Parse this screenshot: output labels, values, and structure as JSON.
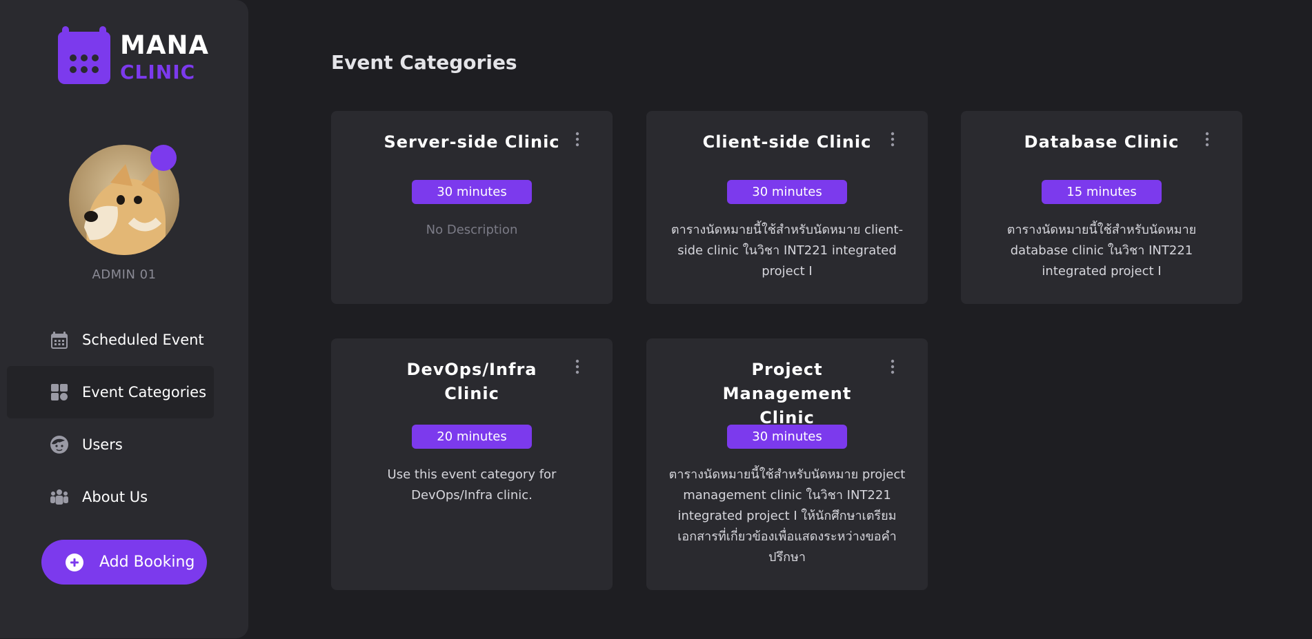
{
  "app": {
    "logo_title": "MANA",
    "logo_subtitle": "CLINIC",
    "accent_color": "#7c3aed"
  },
  "profile": {
    "name": "ADMIN 01",
    "status_color": "#7c3aed"
  },
  "sidebar": {
    "items": [
      {
        "label": "Scheduled Event",
        "icon": "calendar-icon",
        "active": false
      },
      {
        "label": "Event Categories",
        "icon": "grid-icon",
        "active": true
      },
      {
        "label": "Users",
        "icon": "user-face-icon",
        "active": false
      },
      {
        "label": "About Us",
        "icon": "group-icon",
        "active": false
      }
    ],
    "add_booking_label": "Add Booking"
  },
  "main": {
    "title": "Event Categories",
    "cards": [
      {
        "title": "Server-side Clinic",
        "duration": "30 minutes",
        "description": "No Description"
      },
      {
        "title": "Client-side Clinic",
        "duration": "30 minutes",
        "description": "ตารางนัดหมายนี้ใช้สำหรับนัดหมาย client-side clinic ในวิชา INT221 integrated project I"
      },
      {
        "title": "Database Clinic",
        "duration": "15 minutes",
        "description": "ตารางนัดหมายนี้ใช้สำหรับนัดหมาย database clinic ในวิชา INT221 integrated project I"
      },
      {
        "title": "DevOps/Infra Clinic",
        "duration": "20 minutes",
        "description": "Use this event category for DevOps/Infra clinic."
      },
      {
        "title": "Project Management Clinic",
        "duration": "30 minutes",
        "description": "ตารางนัดหมายนี้ใช้สำหรับนัดหมาย project management clinic ในวิชา INT221 integrated project I ให้นักศึกษาเตรียมเอกสารที่เกี่ยวข้องเพื่อแสดงระหว่างขอคำปรึกษา"
      }
    ]
  }
}
